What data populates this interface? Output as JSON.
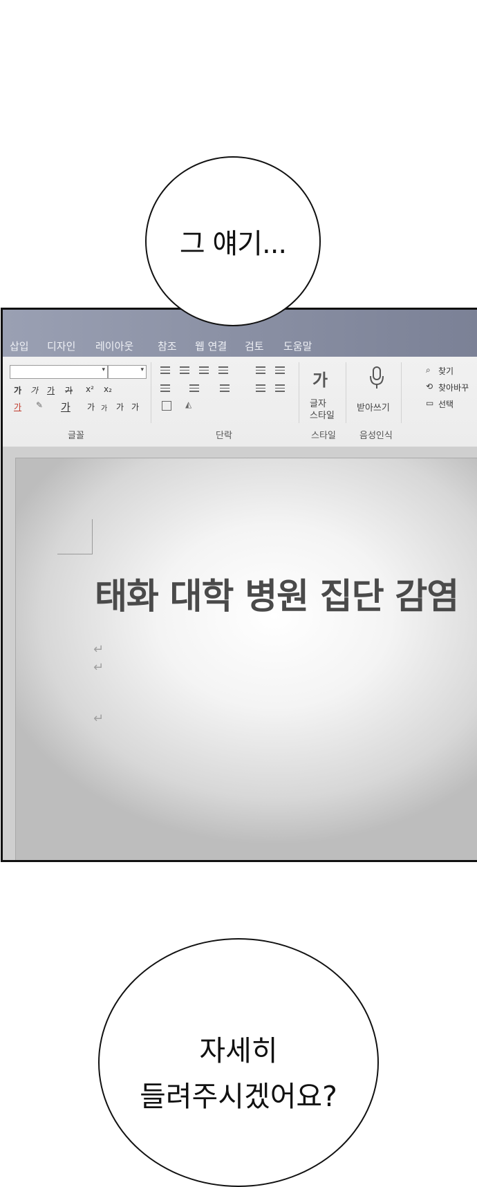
{
  "bubbles": {
    "top": "그 얘기...",
    "bottom_line1": "자세히",
    "bottom_line2": "들려주시겠어요?"
  },
  "menu": [
    "삽입",
    "디자인",
    "레이아웃",
    "참조",
    "웹 연결",
    "검토",
    "도움말"
  ],
  "ribbon": {
    "font_group": {
      "label": "글꼴",
      "row1": [
        "가",
        "가",
        "가",
        "가",
        "x²",
        "x₂"
      ],
      "row2": [
        "가",
        "가",
        "가",
        "가",
        "가",
        "가"
      ]
    },
    "paragraph_group": {
      "label": "단락"
    },
    "style_group": {
      "label": "스타일",
      "button_line1": "글자",
      "button_line2": "스타일",
      "icon_glyph": "가"
    },
    "voice_group": {
      "label": "음성인식",
      "button": "받아쓰기"
    },
    "edit_group": {
      "find": "찾기",
      "replace": "찾아바꾸",
      "select": "선택"
    }
  },
  "document": {
    "title": "태화 대학 병원 집단 감염",
    "paragraph_mark": "↵"
  },
  "colors": {
    "menubar": "#8a90a4",
    "ribbon": "#efefef",
    "title_text": "#4a4a4a"
  }
}
